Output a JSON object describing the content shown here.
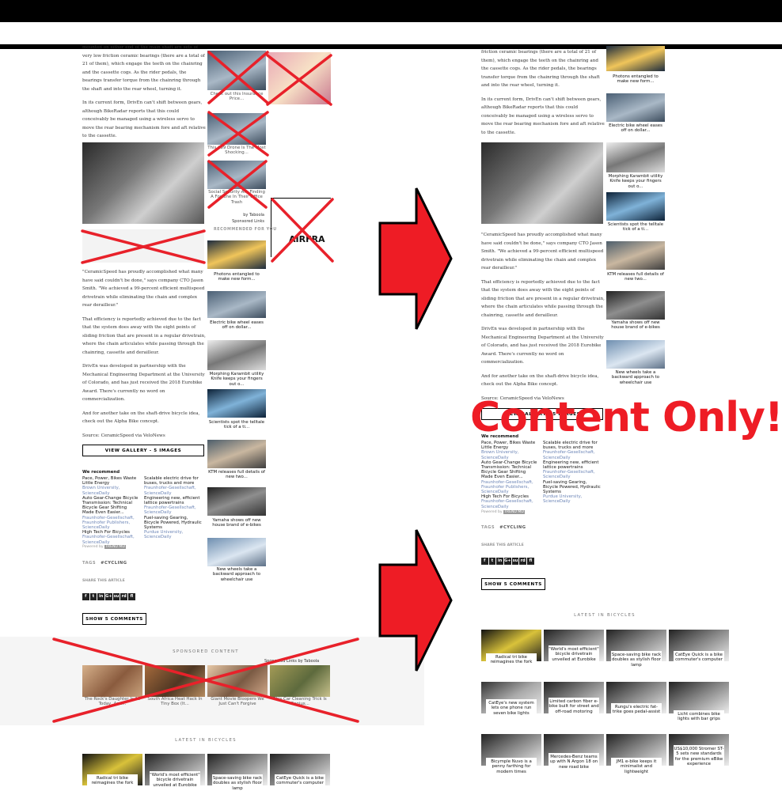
{
  "article": {
    "para_intro": "mounted on either end of the main shaft are sets of very low friction ceramic bearings (there are a total of 21 of them), which engage the teeth on the chainring and the cassette cogs. As the rider pedals, the bearings transfer torque from the chainring through the shaft and into the rear wheel, turning it.",
    "para_intro_right": "friction ceramic bearings (there are a total of 21 of them), which engage the teeth on the chainring and the cassette cogs. As the rider pedals, the bearings transfer torque from the chainring through the shaft and into the rear wheel, turning it.",
    "para_form": "In its current form, DrivEn can't shift between gears, although BikeRadar reports that this could conceivably be managed using a wireless servo to move the rear bearing mechanism fore and aft relative to the cassette.",
    "para_quote": "\"CeramicSpeed has proudly accomplished what many have said couldn't be done,\" says company CTO Jason Smith. \"We achieved a 99-percent efficient multispeed drivetrain while eliminating the chain and complex rear derailleur.\"",
    "para_efficiency": "That efficiency is reportedly achieved due to the fact that the system does away with the eight points of sliding friction that are present in a regular drivetrain, where the chain articulates while passing through the chainring, cassette and derailleur.",
    "para_developed": "DrivEn was developed in partnership with the Mechanical Engineering Department at the University of Colorado, and has just received the 2018 Eurobike Award. There's currently no word on commercialization.",
    "para_another": "And for another take on the shaft-drive bicycle idea, check out the Alpha Bike concept.",
    "source": "Source: CeramicSpeed via VeloNews"
  },
  "gallery_button": "VIEW GALLERY - 5 IMAGES",
  "recommend": {
    "title": "We recommend",
    "left": [
      {
        "title": "Pace, Power, Bikes Waste Little Energy",
        "src": "Brown University, ScienceDaily"
      },
      {
        "title": "Auto Gear-Change Bicycle Transmission: Technical Bicycle Gear Shifting Made Even Easier...",
        "src": "Fraunhofer-Gesellschaft, Fraunhofer Publishers, ScienceDaily"
      },
      {
        "title": "High Tech For Bicycles",
        "src": "Fraunhofer-Gesellschaft, ScienceDaily"
      }
    ],
    "right": [
      {
        "title": "Scalable electric drive for buses, trucks and more",
        "src": "Fraunhofer-Gesellschaft, ScienceDaily"
      },
      {
        "title": "Engineering new, efficient lattice powertrains",
        "src": "Fraunhofer-Gesellschaft, ScienceDaily"
      },
      {
        "title": "Fuel-saving Gearing, Bicycle Powered, Hydraulic Systems",
        "src": "Purdue University, ScienceDaily"
      }
    ],
    "powered": "Powered by",
    "powered_brand": "TREND MD"
  },
  "tags_label": "TAGS",
  "tag_value": "#CYCLING",
  "share_label": "SHARE THIS ARTICLE",
  "share_icons": [
    "f",
    "t",
    "in",
    "G+",
    "su",
    "rd",
    "fl"
  ],
  "comments_button": "SHOW 5 COMMENTS",
  "sponsored": {
    "heading": "SPONSORED CONTENT",
    "by": "Sponsored Links by Taboola",
    "items": [
      "The Rock's Daughter Is 16 Today, And...",
      "South Africa Heat Hack In Tiny Box (It...",
      "Giant Movie Bloopers We Just Can't Forgive",
      "This Car Cleaning Trick Is Genius..."
    ]
  },
  "side_sponsored": {
    "heading": "SPONSORED CONTENT",
    "items": [
      "Check out this Insurance Price...",
      "This $99 Drone Is The Most Shocking...",
      "Social Security Are Finding A Fortune In Their Office Trash"
    ],
    "by": "by Taboola",
    "links": "Sponsored Links",
    "ad_brand": "AIRFRA"
  },
  "recommended_for_you": "RECOMMENDED FOR YOU",
  "sidebar": [
    {
      "caption": "Photons entangled to make new form..."
    },
    {
      "caption": "Electric bike wheel eases off on dollar..."
    },
    {
      "caption": "Morphing Karambit utility Knife keeps your fingers out o..."
    },
    {
      "caption": "Scientists spot the telltale tick of a ti..."
    },
    {
      "caption": "KTM releases full details of new two..."
    },
    {
      "caption": "Yamaha shows off new house brand of e-bikes"
    },
    {
      "caption": "New wheels take a backward approach to wheelchair use"
    }
  ],
  "latest": {
    "heading": "LATEST IN BICYCLES",
    "items": [
      "Radical tri bike reimagines the fork",
      "\"World's most efficient\" bicycle drivetrain unveiled at Eurobike",
      "Space-saving bike rack doubles as stylish floor lamp",
      "CatEye Quick is a bike commuter's computer",
      "CatEye's new system lets one phone run seven bike lights",
      "Limited carbon fiber e-bike built for street and off-road motoring",
      "Rungu's electric fat-trike goes pedal-assist",
      "Licht combines bike lights with bar grips",
      "Bicymple Nuvo is a penny farthing for modern times",
      "Mercedes-Benz teams up with N Argon 18 on new road bike",
      "JM1 e-bike keeps it minimalist and lightweight",
      "US$10,000 Stromer ST-5 sets new standards for the premium eBike experience"
    ]
  },
  "content_only": "Content Only!"
}
